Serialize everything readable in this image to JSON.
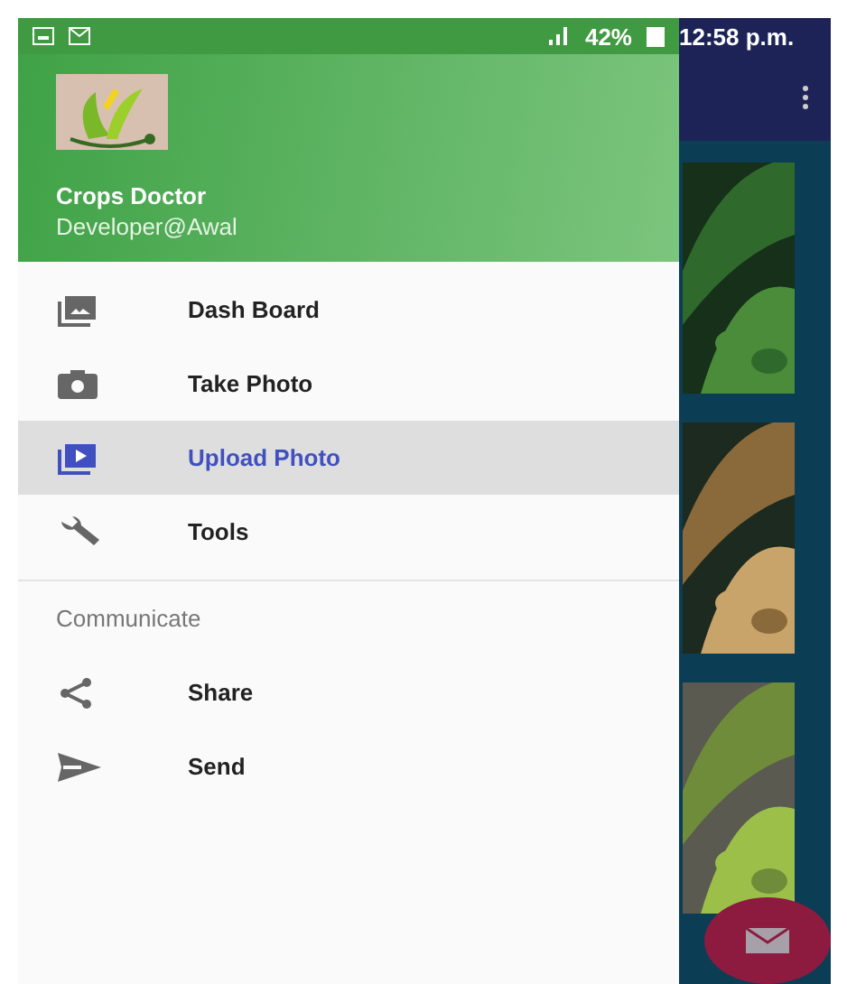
{
  "status_bar": {
    "battery": "42%",
    "time": "12:58 p.m."
  },
  "drawer": {
    "header": {
      "title": "Crops Doctor",
      "subtitle": "Developer@Awal"
    },
    "items": [
      {
        "label": "Dash Board",
        "kind": "gallery",
        "selected": false
      },
      {
        "label": "Take Photo",
        "kind": "camera",
        "selected": false
      },
      {
        "label": "Upload Photo",
        "kind": "video",
        "selected": true
      },
      {
        "label": "Tools",
        "kind": "wrench",
        "selected": false
      }
    ],
    "section": {
      "title": "Communicate",
      "items": [
        {
          "label": "Share",
          "kind": "share",
          "selected": false
        },
        {
          "label": "Send",
          "kind": "send",
          "selected": false
        }
      ]
    }
  }
}
